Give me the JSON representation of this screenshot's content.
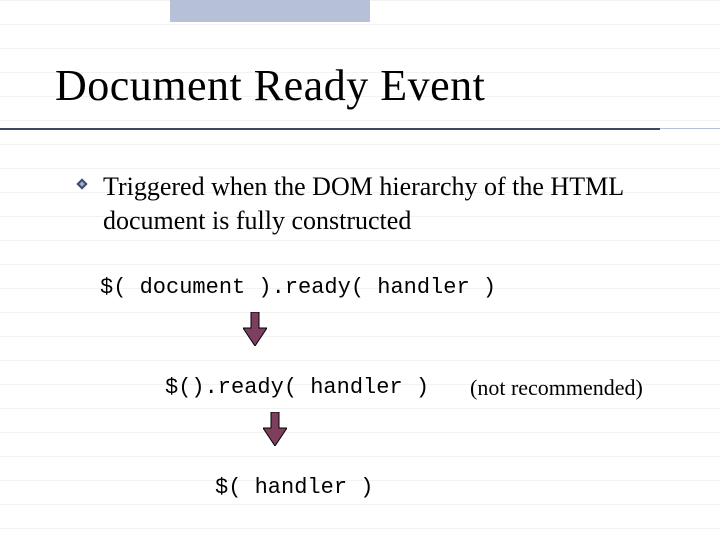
{
  "decor": {
    "strip_color": "#b6c1d8",
    "underline_color": "#404860"
  },
  "title": "Document Ready Event",
  "bullet": {
    "icon_name": "diamond-bullet",
    "text": "Triggered when the DOM hierarchy of the HTML document is fully constructed"
  },
  "code": {
    "line1": "$( document ).ready( handler )",
    "line2": "$().ready( handler )",
    "line3": "$( handler )"
  },
  "note": "(not recommended)",
  "arrow": {
    "fill": "#7e3f5f",
    "stroke": "#000000"
  }
}
